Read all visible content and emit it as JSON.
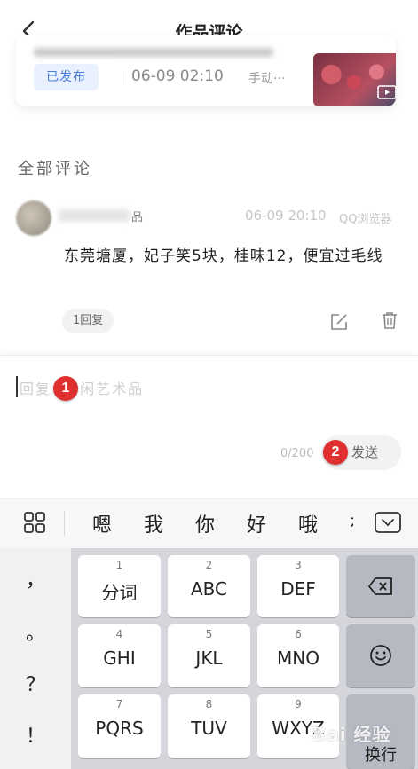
{
  "header": {
    "title": "作品评论",
    "back_icon": "chevron-left-icon"
  },
  "work_card": {
    "status": "已发布",
    "post_time": "06-09 02:10",
    "publish_type": "手动···",
    "thumbnail_icon": "video-play-icon"
  },
  "comments_section": {
    "title": "全部评论",
    "comments": [
      {
        "username_suffix": "品",
        "time": "06-09 20:10",
        "source": "QQ浏览器",
        "text": "东莞塘厦，妃子笑5块，桂味12，便宜过毛线",
        "reply_count": "1回复",
        "edit_icon": "edit-icon",
        "delete_icon": "trash-icon"
      }
    ]
  },
  "reply_box": {
    "placeholder": "回复：  闲艺术品",
    "char_count": "0/200",
    "send_label": "发送"
  },
  "markers": [
    "1",
    "2"
  ],
  "keyboard": {
    "candidates": [
      "嗯",
      "我",
      "你",
      "好",
      "哦",
      "在"
    ],
    "punctuation": [
      "，",
      "。",
      "？",
      "！"
    ],
    "keys": [
      {
        "num": "1",
        "label": "分词"
      },
      {
        "num": "2",
        "label": "ABC"
      },
      {
        "num": "3",
        "label": "DEF"
      },
      {
        "num": "4",
        "label": "GHI"
      },
      {
        "num": "5",
        "label": "JKL"
      },
      {
        "num": "6",
        "label": "MNO"
      },
      {
        "num": "7",
        "label": "PQRS"
      },
      {
        "num": "8",
        "label": "TUV"
      },
      {
        "num": "9",
        "label": "WXYZ"
      }
    ],
    "enter_label": "换行",
    "backspace_icon": "backspace-icon",
    "emoji_icon": "emoji-icon"
  },
  "watermark": "Bai 经验"
}
